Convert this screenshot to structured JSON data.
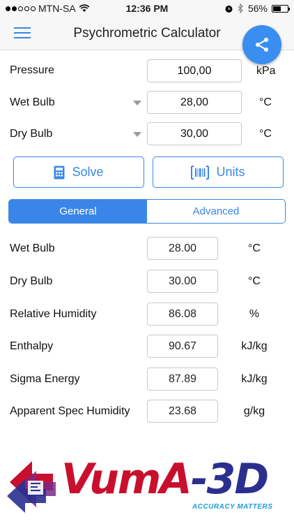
{
  "status_bar": {
    "carrier": "MTN-SA",
    "time": "12:36 PM",
    "battery": "56%",
    "battery_level": 0.56
  },
  "header": {
    "title": "Psychrometric Calculator"
  },
  "inputs": [
    {
      "label": "Pressure",
      "value": "100,00",
      "unit": "kPa",
      "dropdown": false
    },
    {
      "label": "Wet Bulb",
      "value": "28,00",
      "unit": "°C",
      "dropdown": true
    },
    {
      "label": "Dry Bulb",
      "value": "30,00",
      "unit": "°C",
      "dropdown": true
    }
  ],
  "buttons": {
    "solve": "Solve",
    "units": "Units"
  },
  "tabs": {
    "general": "General",
    "advanced": "Advanced",
    "active": "general"
  },
  "results": [
    {
      "label": "Wet Bulb",
      "value": "28.00",
      "unit": "°C"
    },
    {
      "label": "Dry Bulb",
      "value": "30.00",
      "unit": "°C"
    },
    {
      "label": "Relative Humidity",
      "value": "86.08",
      "unit": "%"
    },
    {
      "label": "Enthalpy",
      "value": "90.67",
      "unit": "kJ/kg"
    },
    {
      "label": "Sigma Energy",
      "value": "87.89",
      "unit": "kJ/kg"
    },
    {
      "label": "Apparent Spec Humidity",
      "value": "23.68",
      "unit": "g/kg"
    }
  ],
  "logo": {
    "brand_a": "VumA",
    "brand_b": "-3D",
    "tagline": "ACCURACY MATTERS"
  },
  "colors": {
    "accent": "#3a86e8",
    "logo_red": "#c8102e",
    "logo_blue": "#2a2f8f"
  },
  "icons": [
    "menu-icon",
    "share-icon",
    "calculator-icon",
    "barcode-icon",
    "wifi-icon",
    "alarm-icon",
    "bluetooth-icon",
    "battery-icon"
  ]
}
